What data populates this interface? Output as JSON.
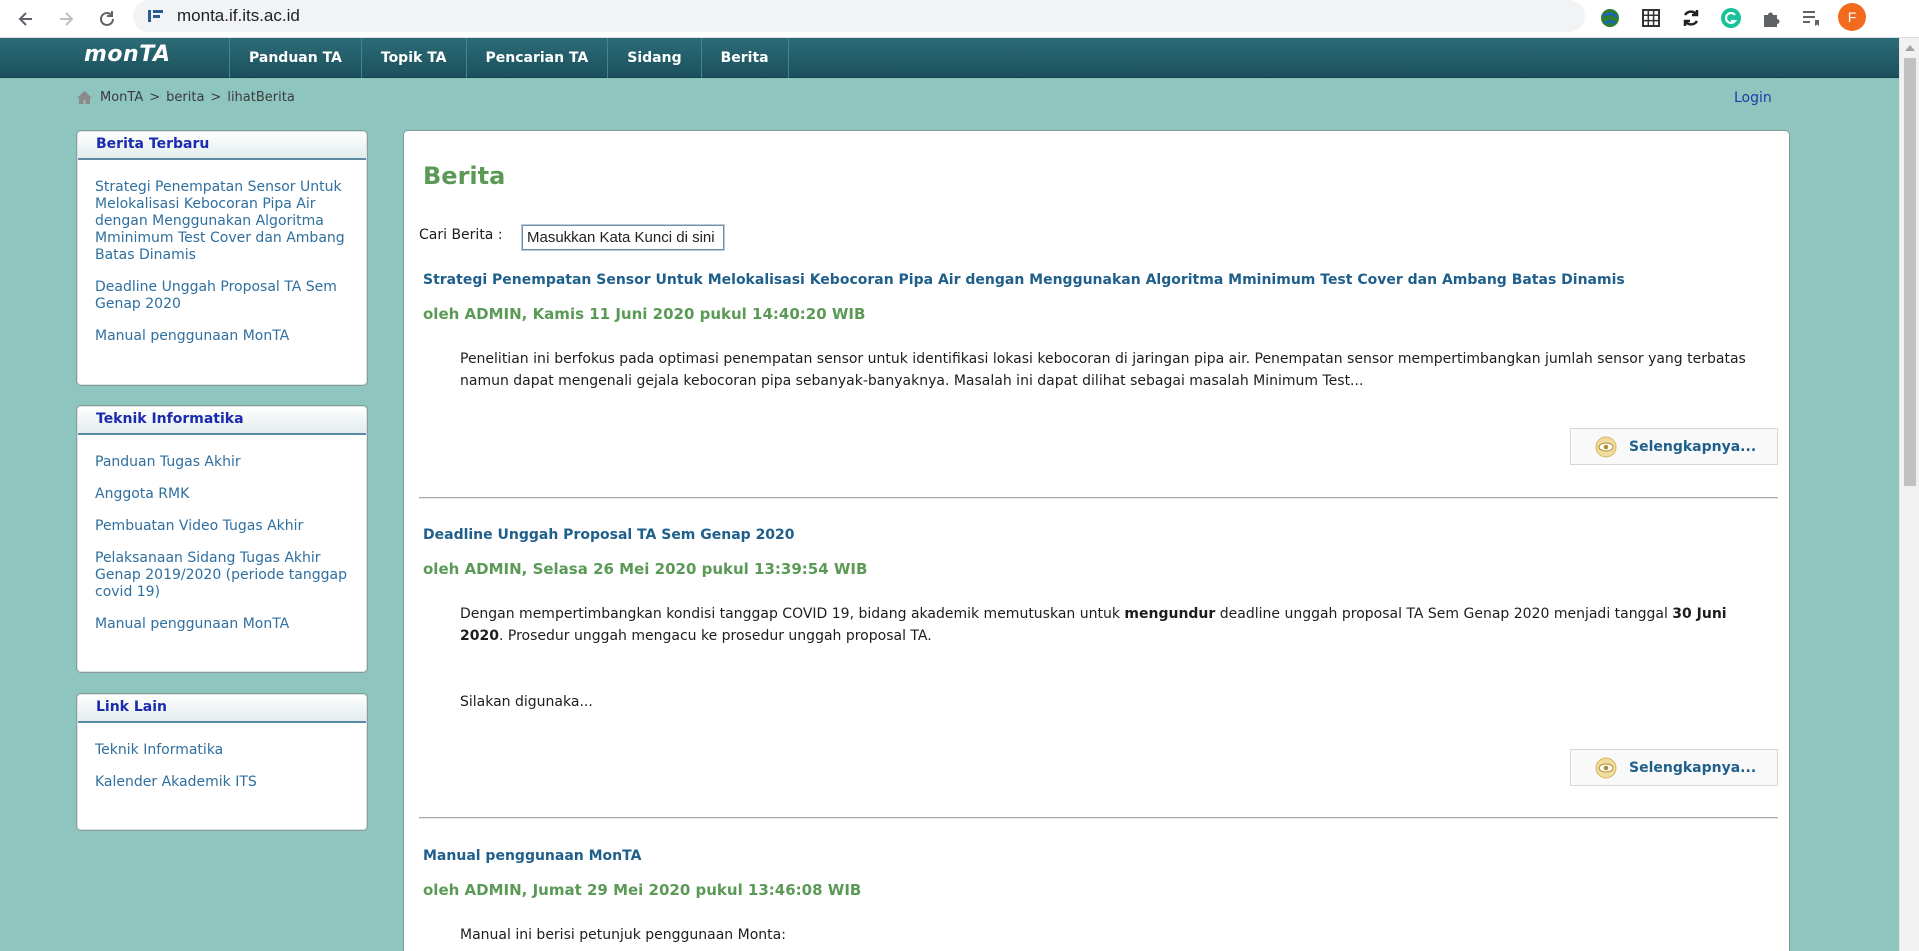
{
  "browser": {
    "url": "monta.if.its.ac.id",
    "profile_initial": "F"
  },
  "site": {
    "logo": "monTA",
    "menu": [
      "Panduan TA",
      "Topik TA",
      "Pencarian TA",
      "Sidang",
      "Berita"
    ],
    "login": "Login"
  },
  "breadcrumb": {
    "items": [
      "MonTA",
      "berita",
      "lihatBerita"
    ],
    "separator": ">"
  },
  "sidebar": {
    "boxes": [
      {
        "title": "Berita Terbaru",
        "links": [
          "Strategi Penempatan Sensor Untuk Melokalisasi Kebocoran Pipa Air dengan Menggunakan Algoritma Mminimum Test Cover dan Ambang Batas Dinamis",
          "Deadline Unggah Proposal TA Sem Genap 2020",
          "Manual penggunaan MonTA"
        ]
      },
      {
        "title": "Teknik Informatika",
        "links": [
          "Panduan Tugas Akhir",
          "Anggota RMK",
          "Pembuatan Video Tugas Akhir",
          "Pelaksanaan Sidang Tugas Akhir Genap 2019/2020 (periode tanggap covid 19)",
          "Manual penggunaan MonTA"
        ]
      },
      {
        "title": "Link Lain",
        "links": [
          "Teknik Informatika",
          "Kalender Akademik ITS"
        ]
      }
    ]
  },
  "main": {
    "title": "Berita",
    "search": {
      "label": "Cari Berita :",
      "placeholder": "Masukkan Kata Kunci di sini"
    },
    "more_label": "Selengkapnya...",
    "news": [
      {
        "title": "Strategi Penempatan Sensor Untuk Melokalisasi Kebocoran Pipa Air dengan Menggunakan Algoritma Mminimum Test Cover dan Ambang Batas Dinamis",
        "meta": "oleh ADMIN, Kamis 11 Juni 2020 pukul 14:40:20 WIB",
        "body": "Penelitian ini berfokus pada optimasi penempatan sensor untuk identifikasi lokasi kebocoran di jaringan pipa air. Penempatan sensor mempertimbangkan jumlah sensor yang terbatas namun dapat mengenali gejala kebocoran pipa sebanyak-banyaknya. Masalah ini dapat dilihat sebagai masalah Minimum Test..."
      },
      {
        "title": "Deadline Unggah Proposal TA Sem Genap 2020",
        "meta": "oleh ADMIN, Selasa 26 Mei 2020 pukul 13:39:54 WIB",
        "body_part1": "Dengan mempertimbangkan kondisi tanggap COVID 19, bidang akademik memutuskan untuk ",
        "body_bold1": "mengundur",
        "body_part2": " deadline unggah proposal TA Sem Genap 2020 menjadi tanggal ",
        "body_bold2": "30 Juni 2020",
        "body_part3": ". Prosedur unggah mengacu ke prosedur unggah proposal TA.",
        "body_extra": "Silakan digunaka..."
      },
      {
        "title": "Manual penggunaan MonTA",
        "meta": "oleh ADMIN, Jumat 29 Mei 2020 pukul 13:46:08 WIB",
        "body": "Manual ini berisi petunjuk penggunaan Monta:"
      }
    ]
  },
  "colors": {
    "page_bg": "#8ec6bf",
    "header_bg": "#1f5b66",
    "title_green": "#5b9a56",
    "link_blue": "#1f5f8b",
    "sidebar_title": "#1a2bb0"
  }
}
